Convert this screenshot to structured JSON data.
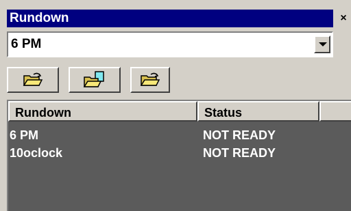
{
  "window": {
    "title": "Rundown",
    "close_label": "×"
  },
  "combo": {
    "selected_value": "6 PM"
  },
  "toolbar": {
    "buttons": [
      {
        "icon": "open-folder-icon"
      },
      {
        "icon": "open-folder-document-icon"
      },
      {
        "icon": "open-folder-icon"
      }
    ]
  },
  "list": {
    "columns": [
      "Rundown",
      "Status",
      ""
    ],
    "rows": [
      {
        "rundown": "6 PM",
        "status": "NOT READY"
      },
      {
        "rundown": "10oclock",
        "status": "NOT READY"
      }
    ]
  },
  "colors": {
    "titlebar": "#000080",
    "list_background": "#5b5b5b",
    "chrome": "#d4d0c8"
  }
}
